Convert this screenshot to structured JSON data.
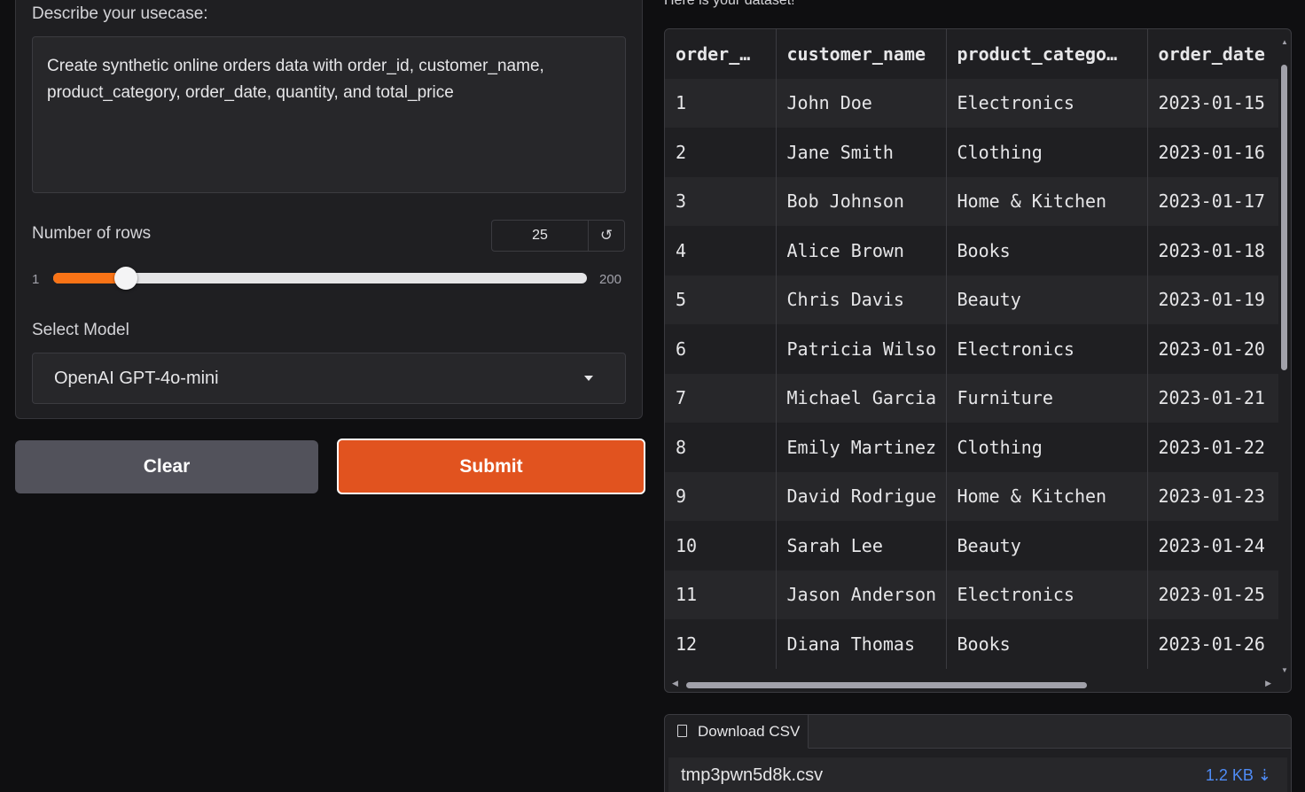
{
  "form": {
    "usecase_label": "Describe your usecase:",
    "usecase_text": "Create synthetic online orders data with order_id, customer_name, product_category, order_date, quantity, and total_price",
    "rows_label": "Number of rows",
    "rows_value": "25",
    "rows_min": "1",
    "rows_max": "200",
    "rows_slider_fraction": 0.1206,
    "reset_icon": "↺",
    "model_label": "Select Model",
    "model_selected": "OpenAI GPT-4o-mini"
  },
  "buttons": {
    "clear_label": "Clear",
    "submit_label": "Submit"
  },
  "colors": {
    "accent": "#e1531f",
    "slider_fill": "#f97316",
    "link": "#4f8cf7"
  },
  "dataset": {
    "label": "Here is your dataset!",
    "columns": [
      "order_…",
      "customer_name",
      "product_catego…",
      "order_date"
    ],
    "rows": [
      [
        "1",
        "John Doe",
        "Electronics",
        "2023-01-15"
      ],
      [
        "2",
        "Jane Smith",
        "Clothing",
        "2023-01-16"
      ],
      [
        "3",
        "Bob Johnson",
        "Home & Kitchen",
        "2023-01-17"
      ],
      [
        "4",
        "Alice Brown",
        "Books",
        "2023-01-18"
      ],
      [
        "5",
        "Chris Davis",
        "Beauty",
        "2023-01-19"
      ],
      [
        "6",
        "Patricia Wilson",
        "Electronics",
        "2023-01-20"
      ],
      [
        "7",
        "Michael Garcia",
        "Furniture",
        "2023-01-21"
      ],
      [
        "8",
        "Emily Martinez",
        "Clothing",
        "2023-01-22"
      ],
      [
        "9",
        "David Rodriguez",
        "Home & Kitchen",
        "2023-01-23"
      ],
      [
        "10",
        "Sarah Lee",
        "Beauty",
        "2023-01-24"
      ],
      [
        "11",
        "Jason Anderson",
        "Electronics",
        "2023-01-25"
      ],
      [
        "12",
        "Diana Thomas",
        "Books",
        "2023-01-26"
      ]
    ]
  },
  "download": {
    "tab_label": "Download CSV",
    "file_name": "tmp3pwn5d8k.csv",
    "file_size": "1.2 KB ⇣"
  }
}
